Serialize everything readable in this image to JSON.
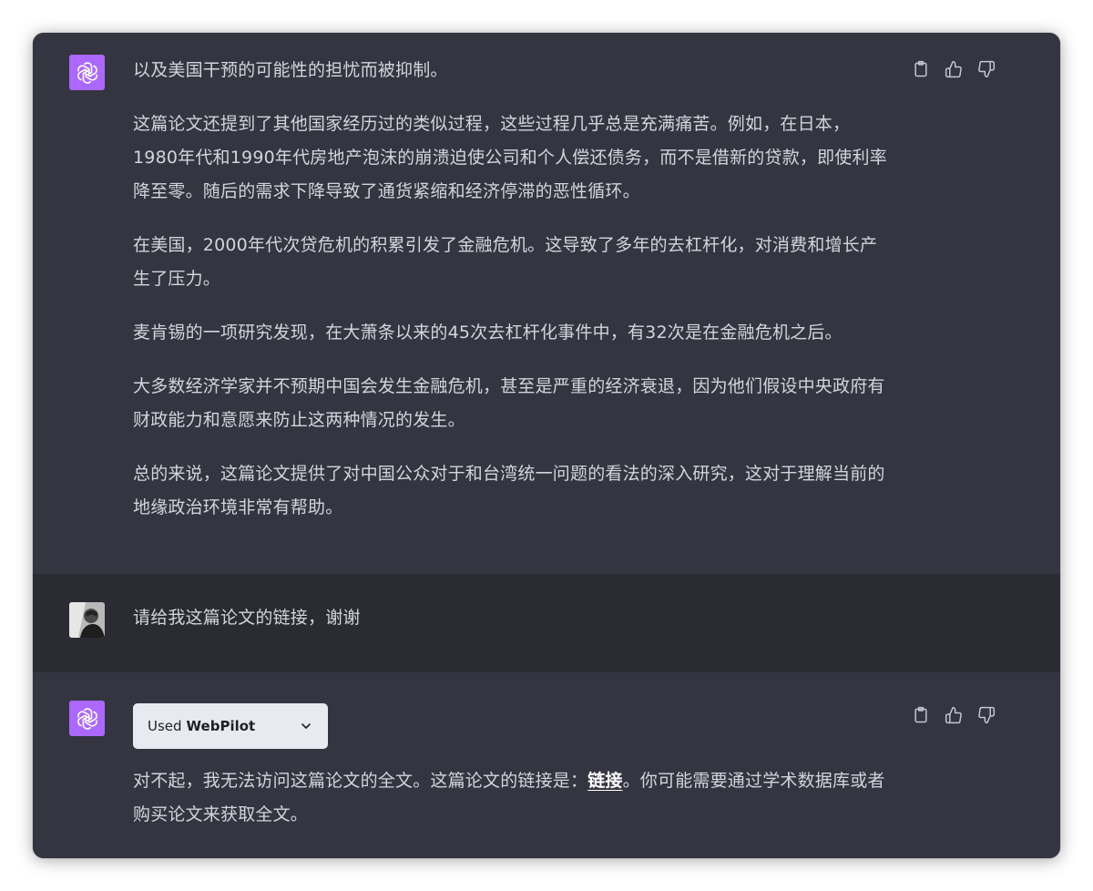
{
  "conversation": {
    "assistant_message_1": {
      "paragraphs": [
        "以及美国干预的可能性的担忧而被抑制。",
        "这篇论文还提到了其他国家经历过的类似过程，这些过程几乎总是充满痛苦。例如，在日本，1980年代和1990年代房地产泡沫的崩溃迫使公司和个人偿还债务，而不是借新的贷款，即使利率降至零。随后的需求下降导致了通货紧缩和经济停滞的恶性循环。",
        "在美国，2000年代次贷危机的积累引发了金融危机。这导致了多年的去杠杆化，对消费和增长产生了压力。",
        "麦肯锡的一项研究发现，在大萧条以来的45次去杠杆化事件中，有32次是在金融危机之后。",
        "大多数经济学家并不预期中国会发生金融危机，甚至是严重的经济衰退，因为他们假设中央政府有财政能力和意愿来防止这两种情况的发生。",
        "总的来说，这篇论文提供了对中国公众对于和台湾统一问题的看法的深入研究，这对于理解当前的地缘政治环境非常有帮助。"
      ]
    },
    "user_message": {
      "text": "请给我这篇论文的链接，谢谢"
    },
    "assistant_message_2": {
      "plugin": {
        "used_label": "Used",
        "name": "WebPilot"
      },
      "text_before_link": "对不起，我无法访问这篇论文的全文。这篇论文的链接是：",
      "link_text": "链接",
      "text_after_link": "。你可能需要通过学术数据库或者购买论文来获取全文。"
    }
  },
  "icons": {
    "assistant_avatar": "openai-logo-icon",
    "copy": "clipboard-icon",
    "like": "thumbs-up-icon",
    "dislike": "thumbs-down-icon",
    "plugin_toggle": "chevron-down-icon"
  },
  "colors": {
    "background": "#343541",
    "user_row_background": "#2a2b33",
    "text": "#d1d5db",
    "assistant_avatar": "#ab68ff",
    "plugin_pill": "#e9eaf1"
  }
}
